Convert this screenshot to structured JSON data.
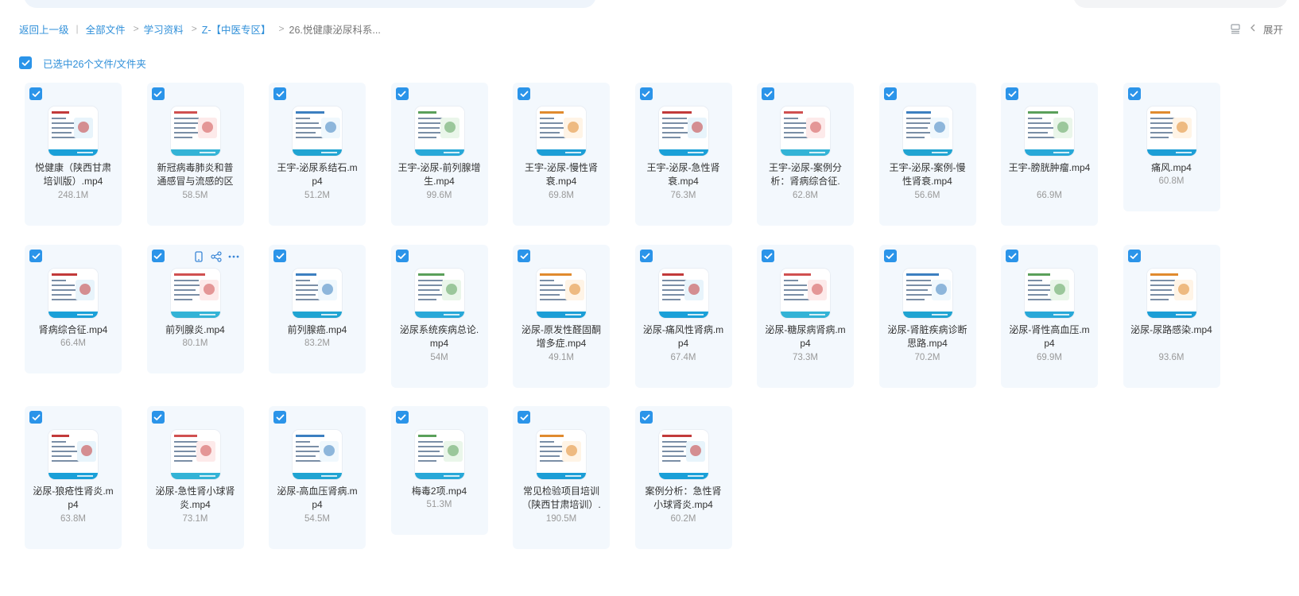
{
  "breadcrumb": {
    "back": "返回上一级",
    "items": [
      "全部文件",
      "学习资料",
      "Z-【中医专区】"
    ],
    "current": "26.悦健康泌尿科系..."
  },
  "toolbar": {
    "expand_label": "展开"
  },
  "selection": {
    "text": "已选中26个文件/文件夹"
  },
  "colors": {
    "accent": "#2b94e9",
    "card_bg": "#f3f8fd"
  },
  "files": [
    {
      "name": "悦健康（陕西甘肃培训版）.mp4",
      "size": "248.1M",
      "lines": 2
    },
    {
      "name": "新冠病毒肺炎和普通感冒与流感的区",
      "size": "58.5M",
      "lines": 2
    },
    {
      "name": "王宇-泌尿系结石.mp4",
      "size": "51.2M",
      "lines": 2
    },
    {
      "name": "王宇-泌尿-前列腺增生.mp4",
      "size": "99.6M",
      "lines": 2
    },
    {
      "name": "王宇-泌尿-慢性肾衰.mp4",
      "size": "69.8M",
      "lines": 2
    },
    {
      "name": "王宇-泌尿-急性肾衰.mp4",
      "size": "76.3M",
      "lines": 2
    },
    {
      "name": "王宇-泌尿-案例分析：肾病综合征.",
      "size": "62.8M",
      "lines": 2
    },
    {
      "name": "王宇-泌尿-案例-慢性肾衰.mp4",
      "size": "56.6M",
      "lines": 2
    },
    {
      "name": "王宇-膀胱肿瘤.mp4",
      "size": "66.9M",
      "lines": 2
    },
    {
      "name": "痛风.mp4",
      "size": "60.8M",
      "lines": 1
    },
    {
      "name": "肾病综合征.mp4",
      "size": "66.4M",
      "lines": 1
    },
    {
      "name": "前列腺炎.mp4",
      "size": "80.1M",
      "lines": 1
    },
    {
      "name": "前列腺癌.mp4",
      "size": "83.2M",
      "lines": 1
    },
    {
      "name": "泌尿系统疾病总论.mp4",
      "size": "54M",
      "lines": 2
    },
    {
      "name": "泌尿-原发性醛固酮增多症.mp4",
      "size": "49.1M",
      "lines": 2
    },
    {
      "name": "泌尿-痛风性肾病.mp4",
      "size": "67.4M",
      "lines": 2
    },
    {
      "name": "泌尿-糖尿病肾病.mp4",
      "size": "73.3M",
      "lines": 2
    },
    {
      "name": "泌尿-肾脏疾病诊断思路.mp4",
      "size": "70.2M",
      "lines": 2
    },
    {
      "name": "泌尿-肾性高血压.mp4",
      "size": "69.9M",
      "lines": 2
    },
    {
      "name": "泌尿-尿路感染.mp4",
      "size": "93.6M",
      "lines": 2
    },
    {
      "name": "泌尿-狼疮性肾炎.mp4",
      "size": "63.8M",
      "lines": 2
    },
    {
      "name": "泌尿-急性肾小球肾炎.mp4",
      "size": "73.1M",
      "lines": 2
    },
    {
      "name": "泌尿-高血压肾病.mp4",
      "size": "54.5M",
      "lines": 2
    },
    {
      "name": "梅毒2项.mp4",
      "size": "51.3M",
      "lines": 1
    },
    {
      "name": "常见检验项目培训（陕西甘肃培训）.",
      "size": "190.5M",
      "lines": 2
    },
    {
      "name": "案例分析：急性肾小球肾炎.mp4",
      "size": "60.2M",
      "lines": 2
    }
  ]
}
